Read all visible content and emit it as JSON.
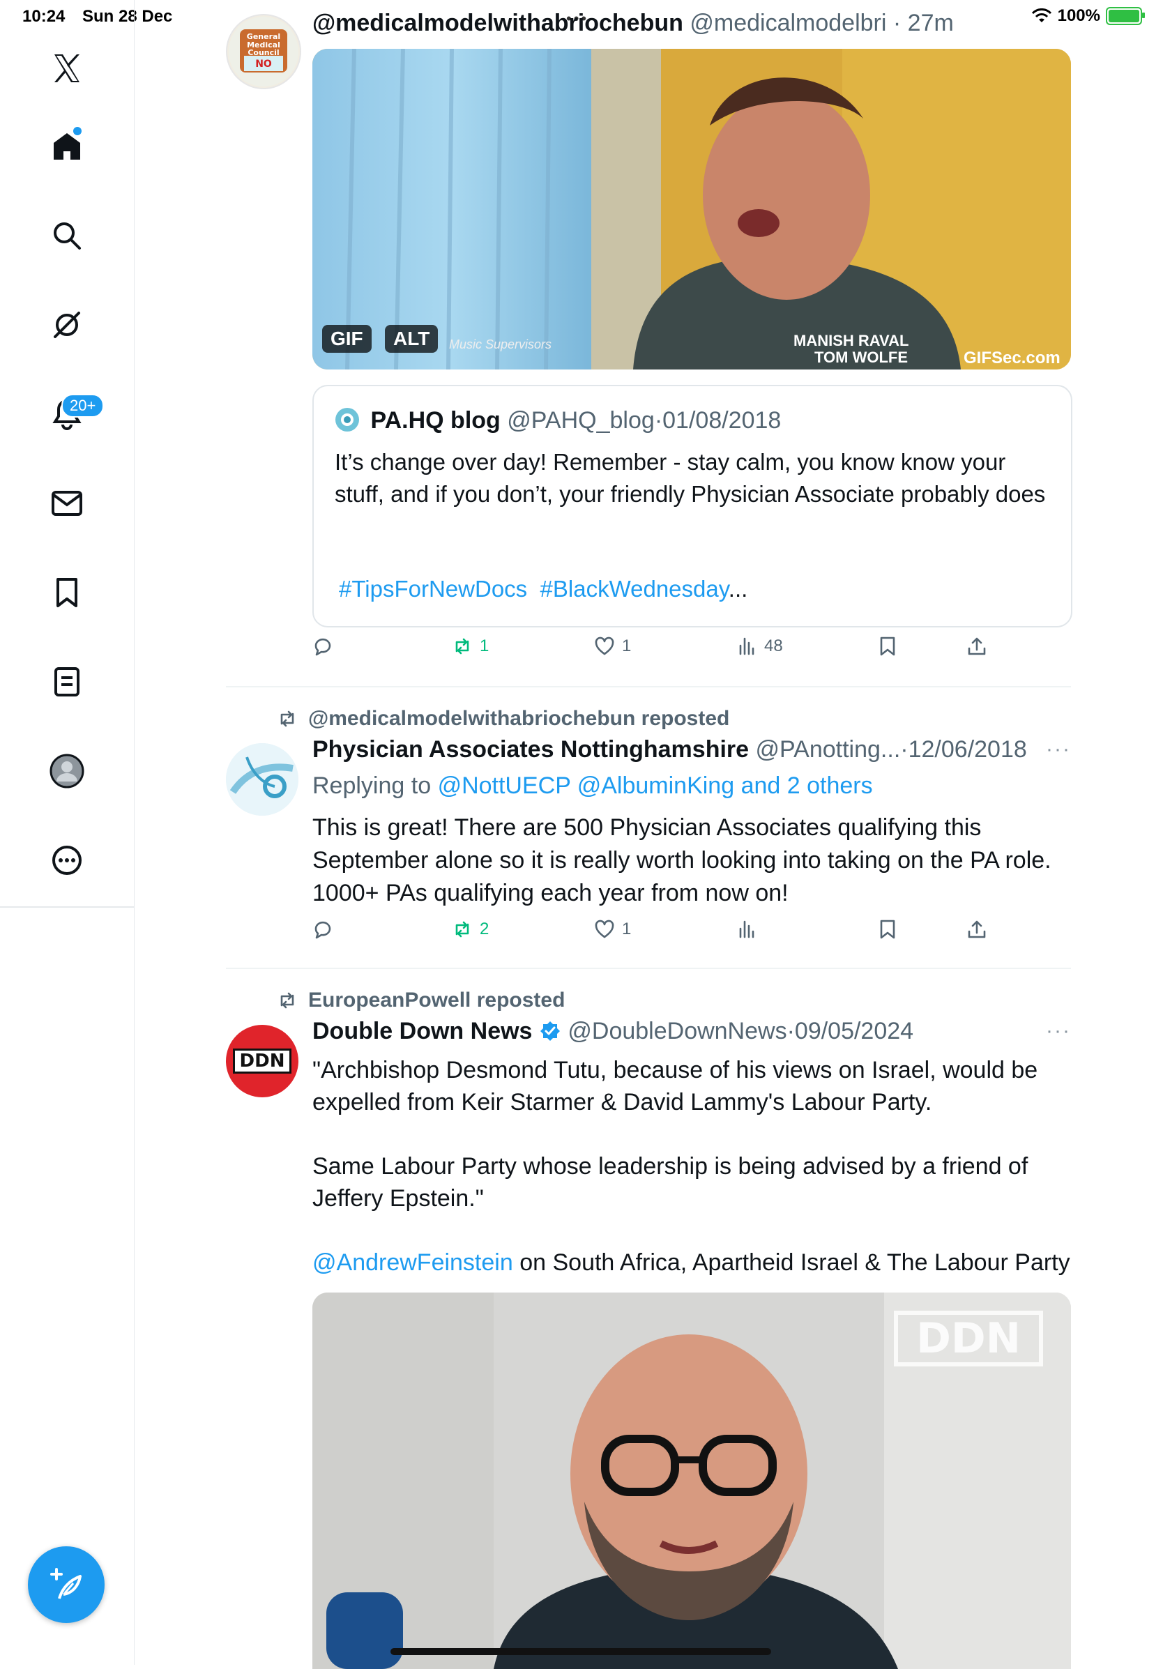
{
  "status_bar": {
    "time": "10:24",
    "date": "Sun 28 Dec",
    "dots": "•••",
    "battery": "100%"
  },
  "sidebar": {
    "items": [
      {
        "name": "x-logo-icon"
      },
      {
        "name": "home-icon"
      },
      {
        "name": "search-icon"
      },
      {
        "name": "grok-icon"
      },
      {
        "name": "notifications-icon"
      },
      {
        "name": "messages-icon"
      },
      {
        "name": "bookmarks-icon"
      },
      {
        "name": "lists-icon"
      },
      {
        "name": "profile-icon"
      },
      {
        "name": "more-icon"
      }
    ],
    "notifications_badge": "20+",
    "compose": "compose-icon"
  },
  "colors": {
    "accent": "#1d9bf0",
    "repost_green": "#00ba7c",
    "secondary_text": "#536471",
    "ddn_red": "#e0242b"
  },
  "tweets": [
    {
      "display_name": "@medicalmodelwithabriochebun",
      "handle": "@medicalmodelbri",
      "time": "27m",
      "avatar_text": "General Medical Council NO",
      "media": {
        "badge_gif": "GIF",
        "badge_alt": "ALT",
        "caption_left": "Music Supervisors",
        "caption_name_1": "MANISH RAVAL",
        "caption_name_2": "TOM WOLFE",
        "watermark": "GIFSec.com"
      },
      "quote": {
        "name": "PA.HQ blog",
        "handle": "@PAHQ_blog",
        "date": "01/08/2018",
        "text": "It’s change over day! Remember - stay calm, you know know your stuff, and if you don’t, your friendly Physician Associate probably does",
        "hashtag_1": "#TipsForNewDocs",
        "hashtag_2": "#BlackWednesday",
        "ellipsis": "..."
      },
      "actions": {
        "replies": "",
        "reposts": "1",
        "likes": "1",
        "views": "48"
      }
    },
    {
      "repost_by": "@medicalmodelwithabriochebun reposted",
      "display_name": "Physician Associates Nottinghamshire",
      "handle": "@PAnotting...",
      "date": "12/06/2018",
      "reply_prefix": "Replying to",
      "reply_targets": "@NottUECP @AlbuminKing and 2 others",
      "text": "This is great! There are 500 Physician Associates qualifying this September alone so it is really worth looking into taking on the PA role. 1000+ PAs qualifying each year from now on!",
      "actions": {
        "replies": "",
        "reposts": "2",
        "likes": "1",
        "views": ""
      }
    },
    {
      "repost_by": "EuropeanPowell reposted",
      "display_name": "Double Down News",
      "handle": "@DoubleDownNews",
      "date": "09/05/2024",
      "avatar_text": "DDN",
      "text_p1": "\"Archbishop Desmond Tutu, because of his views on Israel, would be expelled from Keir Starmer & David Lammy's Labour Party.",
      "text_p2": "Same Labour Party whose leadership is being advised by a friend of Jeffery Epstein.\"",
      "mention": "@AndrewFeinstein",
      "text_p3": " on South Africa, Apartheid Israel & The Labour Party",
      "media_watermark": "DDN"
    }
  ]
}
